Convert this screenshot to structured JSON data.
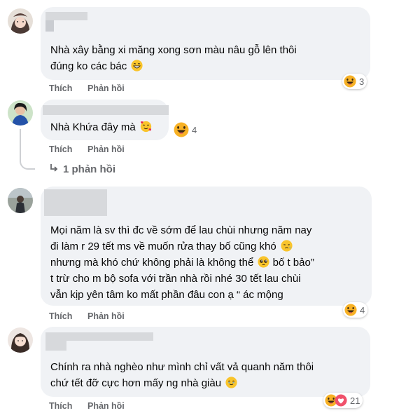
{
  "actions": {
    "like": "Thích",
    "reply": "Phản hồi"
  },
  "comments": [
    {
      "lines": [
        "Nhà xây bằng xi măng xong sơn màu nâu gỗ lên thôi",
        "đúng ko các bác"
      ],
      "reaction_count": "3"
    },
    {
      "lines": [
        "Nhà Khứa đây mà"
      ],
      "reaction_count": "4",
      "replies_link": "1 phản hồi"
    },
    {
      "lines": [
        "Mọi năm là sv thì đc về sớm để lau chùi nhưng năm nay",
        "đi làm r 29 tết ms về muốn rửa thay bố cũng khó",
        "nhưng mà khó chứ không phải là không thể",
        "bố t bảo”",
        "t trừ cho m bộ sofa với trần nhà rồi nhé 30 tết lau chùi",
        "vẫn kịp yên tâm ko mất phần đâu con ạ “ ác mộng"
      ],
      "reaction_count": "4"
    },
    {
      "lines": [
        "Chính ra nhà nghèo như mình chỉ vất vả quanh năm thôi",
        "chứ tết đỡ cực hơn mấy ng nhà giàu"
      ],
      "reaction_count": "21"
    }
  ],
  "icons": {
    "laugh": "laugh-react-icon",
    "love": "love-react-icon",
    "grin": "grin-sweat-icon",
    "smile_hearts": "smiling-face-hearts-icon",
    "sleepy": "sleepy-face-icon",
    "pleading": "pleading-face-icon",
    "teary_smile": "holding-back-tears-icon",
    "reply_arrow": "reply-arrow-icon"
  }
}
